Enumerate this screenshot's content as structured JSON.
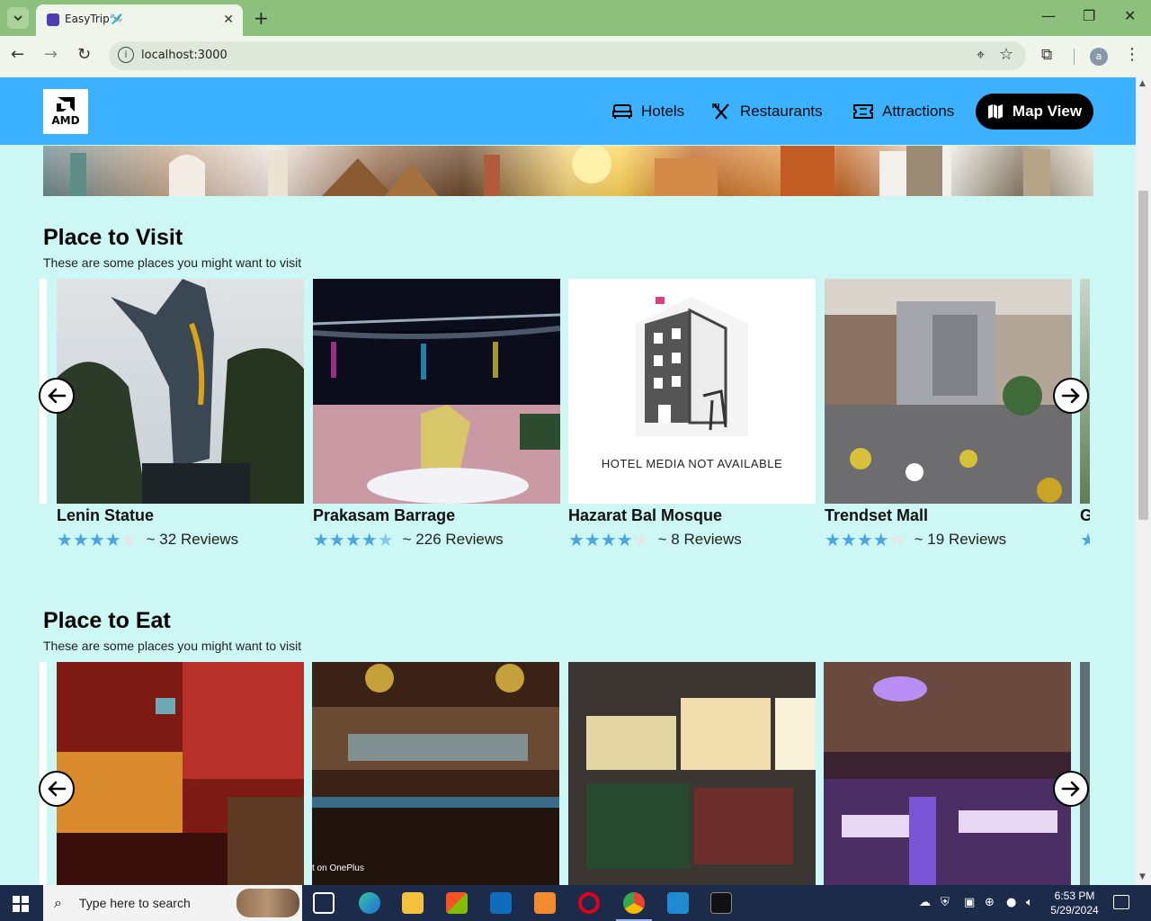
{
  "browser": {
    "tab_title": "EasyTrip🛩️",
    "url": "localhost:3000",
    "profile_initial": "a"
  },
  "header": {
    "logo_text": "AMD",
    "nav": [
      {
        "label": "Hotels",
        "icon": "bed-icon"
      },
      {
        "label": "Restaurants",
        "icon": "utensils-icon"
      },
      {
        "label": "Attractions",
        "icon": "ticket-icon"
      }
    ],
    "map_view_label": "Map View"
  },
  "visit": {
    "title": "Place to Visit",
    "subtitle": "These are some places you might want to visit",
    "cards": [
      {
        "name": "Lenin Statue",
        "rating": 4,
        "reviews": "~ 32 Reviews"
      },
      {
        "name": "Prakasam Barrage",
        "rating": 4.5,
        "reviews": "~ 226 Reviews"
      },
      {
        "name": "Hazarat Bal Mosque",
        "rating": 4,
        "reviews": "~ 8 Reviews",
        "placeholder_text": "HOTEL MEDIA NOT AVAILABLE"
      },
      {
        "name": "Trendset Mall",
        "rating": 4,
        "reviews": "~ 19 Reviews"
      },
      {
        "name": "G",
        "rating": 4,
        "reviews": ""
      }
    ]
  },
  "eat": {
    "title": "Place to Eat",
    "subtitle": "These are some places you might want to visit",
    "cards": [
      {
        "name": "",
        "caption": ""
      },
      {
        "name": "",
        "caption": "t on OnePlus"
      },
      {
        "name": "",
        "caption": ""
      },
      {
        "name": "",
        "caption": ""
      }
    ]
  },
  "taskbar": {
    "search_placeholder": "Type here to search",
    "time": "6:53 PM",
    "date": "5/29/2024"
  },
  "colors": {
    "header_bg": "#3cb1ff",
    "page_bg": "#ccf7f5",
    "star": "#4aa5e0",
    "map_view_bg": "#000000"
  }
}
